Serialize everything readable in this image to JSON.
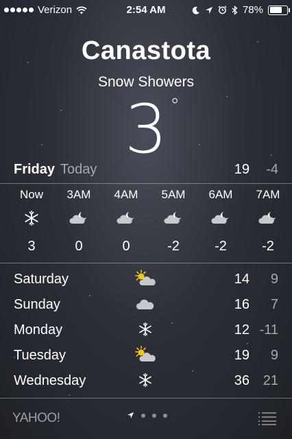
{
  "status_bar": {
    "carrier": "Verizon",
    "time": "2:54 AM",
    "battery_percent": "78%",
    "battery_level": 0.78,
    "icons": [
      "signal-dots-icon",
      "wifi-icon",
      "moon-icon",
      "location-arrow-icon",
      "alarm-clock-icon",
      "bluetooth-icon",
      "battery-icon"
    ]
  },
  "location": {
    "city": "Canastota",
    "condition": "Snow Showers",
    "temperature": "3",
    "degree_symbol": "°"
  },
  "today": {
    "day": "Friday",
    "label": "Today",
    "high": "19",
    "low": "-4"
  },
  "hourly": [
    {
      "time": "Now",
      "icon": "snowflake-icon",
      "temp": "3"
    },
    {
      "time": "3AM",
      "icon": "partly-cloudy-night-icon",
      "temp": "0"
    },
    {
      "time": "4AM",
      "icon": "partly-cloudy-night-icon",
      "temp": "0"
    },
    {
      "time": "5AM",
      "icon": "partly-cloudy-night-icon",
      "temp": "-2"
    },
    {
      "time": "6AM",
      "icon": "partly-cloudy-night-icon",
      "temp": "-2"
    },
    {
      "time": "7AM",
      "icon": "partly-cloudy-night-icon",
      "temp": "-2"
    }
  ],
  "daily": [
    {
      "day": "Saturday",
      "icon": "partly-sunny-icon",
      "high": "14",
      "low": "9"
    },
    {
      "day": "Sunday",
      "icon": "cloud-icon",
      "high": "16",
      "low": "7"
    },
    {
      "day": "Monday",
      "icon": "snowflake-icon",
      "high": "12",
      "low": "-11"
    },
    {
      "day": "Tuesday",
      "icon": "partly-sunny-icon",
      "high": "19",
      "low": "9"
    },
    {
      "day": "Wednesday",
      "icon": "snowflake-icon",
      "high": "36",
      "low": "21"
    }
  ],
  "footer": {
    "brand": "YAHOO!",
    "icons": [
      "location-arrow-icon",
      "page-dot-icon",
      "list-menu-icon"
    ]
  },
  "colors": {
    "text_primary": "#ffffff",
    "text_secondary": "#a7a9ad",
    "sun": "#f5c518",
    "cloud": "#c7c9cc"
  }
}
